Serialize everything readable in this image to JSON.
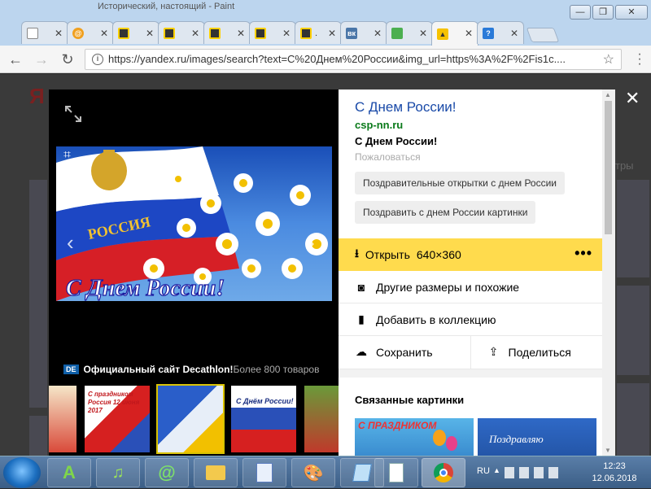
{
  "window": {
    "title": "Исторический, настоящий - Paint",
    "min_label": "—",
    "max_label": "❐",
    "close_label": "✕"
  },
  "tabs": [
    {
      "icon": "page-icon",
      "label": ""
    },
    {
      "icon": "mail-icon",
      "label": ""
    },
    {
      "icon": "doc-icon",
      "label": ""
    },
    {
      "icon": "doc-icon",
      "label": ""
    },
    {
      "icon": "doc-icon",
      "label": ""
    },
    {
      "icon": "doc-icon",
      "label": ""
    },
    {
      "icon": "doc-icon",
      "label": "."
    },
    {
      "icon": "vk-icon",
      "label": ""
    },
    {
      "icon": "green-square-icon",
      "label": ""
    },
    {
      "icon": "image-icon",
      "label": ""
    },
    {
      "icon": "help-icon",
      "label": ""
    }
  ],
  "toolbar": {
    "url": "https://yandex.ru/images/search?text=С%20Днем%20России&img_url=https%3A%2F%2Fis1c...."
  },
  "page": {
    "bg_logo": "Я",
    "bg_text": "тры"
  },
  "viewer": {
    "ad_badge": "DE",
    "ad_title": "Официальный сайт Decathlon!",
    "ad_rest": " Более 800 товаров"
  },
  "panel": {
    "title": "С Днем России!",
    "domain": "csp-nn.ru",
    "description": "С Днем России!",
    "complain": "Пожаловаться",
    "tags": [
      "Поздравительные открытки с днем России",
      "Поздравить с днем России картинки"
    ],
    "open_label": "Открыть",
    "open_size": "640×360",
    "actions": {
      "other_sizes": "Другие размеры и похожие",
      "add_collection": "Добавить в коллекцию",
      "save": "Сохранить",
      "share": "Поделиться"
    },
    "related_heading": "Связанные картинки",
    "related_texts": [
      "С ПРАЗДНИКОМ",
      "Поздравляю"
    ]
  },
  "thumbs": [
    {
      "caption": ""
    },
    {
      "caption": "С праздником Россия 12 июня 2017"
    },
    {
      "caption": ""
    },
    {
      "caption": "С Днём России!"
    },
    {
      "caption": ""
    }
  ],
  "main_image_text": "С Днем России!",
  "flag_text": "РОССИЯ",
  "taskbar": {
    "lang": "RU",
    "time": "12:23",
    "date": "12.06.2018"
  },
  "colors": {
    "accent_yellow": "#ffdb4d",
    "link_blue": "#1a4aa8",
    "domain_green": "#0a7a1a"
  }
}
